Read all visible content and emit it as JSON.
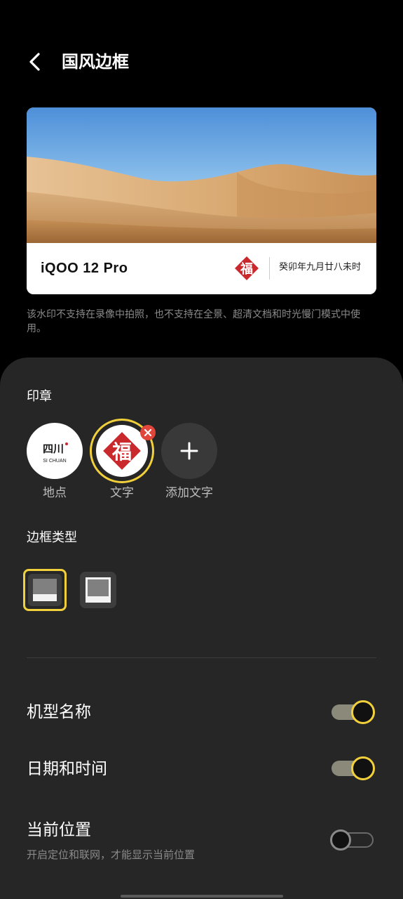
{
  "header": {
    "title": "国风边框"
  },
  "preview": {
    "model_name": "iQOO 12 Pro",
    "stamp_char": "福",
    "datetime": "癸卯年九月廿八未时"
  },
  "notice": "该水印不支持在录像中拍照，也不支持在全景、超清文档和时光慢门模式中使用。",
  "seal_section": {
    "title": "印章",
    "items": [
      {
        "label": "地点",
        "stamp_text": "四川",
        "stamp_sub": "SI CHUAN",
        "selected": false
      },
      {
        "label": "文字",
        "stamp_text": "福",
        "selected": true
      },
      {
        "label": "添加文字",
        "selected": false
      }
    ]
  },
  "border_section": {
    "title": "边框类型",
    "options": [
      {
        "name": "bottom-bar",
        "selected": true
      },
      {
        "name": "full-frame",
        "selected": false
      }
    ]
  },
  "settings": [
    {
      "label": "机型名称",
      "enabled": true
    },
    {
      "label": "日期和时间",
      "enabled": true
    },
    {
      "label": "当前位置",
      "subtitle": "开启定位和联网，才能显示当前位置",
      "enabled": false
    }
  ],
  "colors": {
    "accent": "#f2d03b",
    "sheet_bg": "#262626",
    "stamp_red": "#c9282d",
    "delete_red": "#e0463c"
  }
}
